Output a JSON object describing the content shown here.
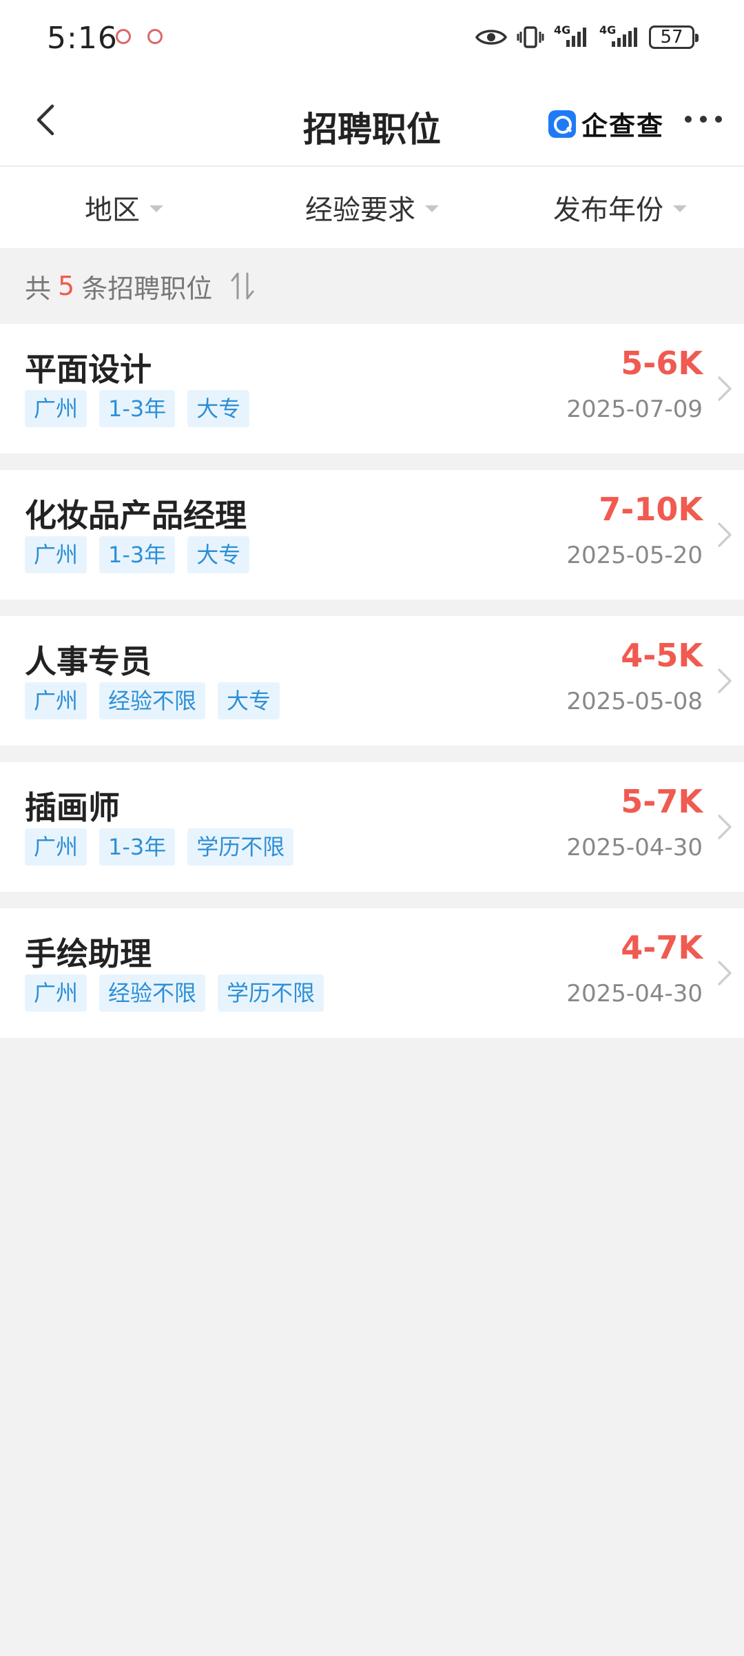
{
  "status_bar": {
    "time": "5:16",
    "network_1": "4G",
    "network_2": "4G",
    "battery": "57"
  },
  "nav": {
    "title": "招聘职位",
    "brand": "企查查"
  },
  "filters": [
    {
      "label": "地区"
    },
    {
      "label": "经验要求"
    },
    {
      "label": "发布年份"
    }
  ],
  "summary": {
    "prefix": "共",
    "count": "5",
    "suffix": "条招聘职位"
  },
  "jobs": [
    {
      "title": "平面设计",
      "salary": "5-6K",
      "date": "2025-07-09",
      "tags": [
        "广州",
        "1-3年",
        "大专"
      ]
    },
    {
      "title": "化妆品产品经理",
      "salary": "7-10K",
      "date": "2025-05-20",
      "tags": [
        "广州",
        "1-3年",
        "大专"
      ]
    },
    {
      "title": "人事专员",
      "salary": "4-5K",
      "date": "2025-05-08",
      "tags": [
        "广州",
        "经验不限",
        "大专"
      ]
    },
    {
      "title": "插画师",
      "salary": "5-7K",
      "date": "2025-04-30",
      "tags": [
        "广州",
        "1-3年",
        "学历不限"
      ]
    },
    {
      "title": "手绘助理",
      "salary": "4-7K",
      "date": "2025-04-30",
      "tags": [
        "广州",
        "经验不限",
        "学历不限"
      ]
    }
  ],
  "colors": {
    "accent_red": "#f05a50",
    "tag_blue": "#2d8fd6",
    "tag_bg": "#e8f4fd",
    "brand_blue": "#1e7bf5"
  }
}
